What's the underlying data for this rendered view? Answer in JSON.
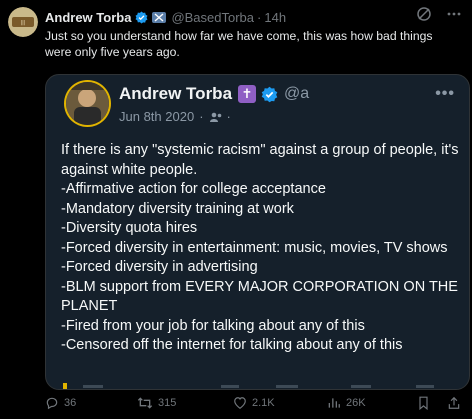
{
  "post": {
    "author_name": "Andrew Torba",
    "handle": "@BasedTorba",
    "separator": "·",
    "time": "14h",
    "text": "Just so you understand how far we have come, this was how bad things were only five years ago."
  },
  "quoted": {
    "author_name": "Andrew Torba",
    "cross_symbol": "✝",
    "handle": "@a",
    "date": "Jun 8th 2020",
    "separator": "·",
    "more": "•••",
    "lines": [
      "If there is any \"systemic racism\" against a group of people, it's against white people.",
      "-Affirmative action for college acceptance",
      "-Mandatory diversity training at work",
      "-Diversity quota hires",
      "-Forced diversity in entertainment: music, movies, TV shows",
      "-Forced diversity in advertising",
      "-BLM support from EVERY MAJOR CORPORATION ON THE PLANET",
      "-Fired from your job for talking about any of this",
      "-Censored off the internet for talking about any of this"
    ]
  },
  "actions": {
    "replies": "36",
    "reposts": "315",
    "likes": "2.1K",
    "views": "26K"
  },
  "colors": {
    "background": "#000000",
    "verified": "#1d9bf0",
    "quote_bg": "#15202b",
    "cross_badge": "#8f5fc4"
  },
  "icons": [
    "verified-badge-icon",
    "flag-icon",
    "grok-icon",
    "more-icon",
    "reply-icon",
    "repost-icon",
    "like-icon",
    "views-icon",
    "bookmark-icon",
    "share-icon"
  ]
}
